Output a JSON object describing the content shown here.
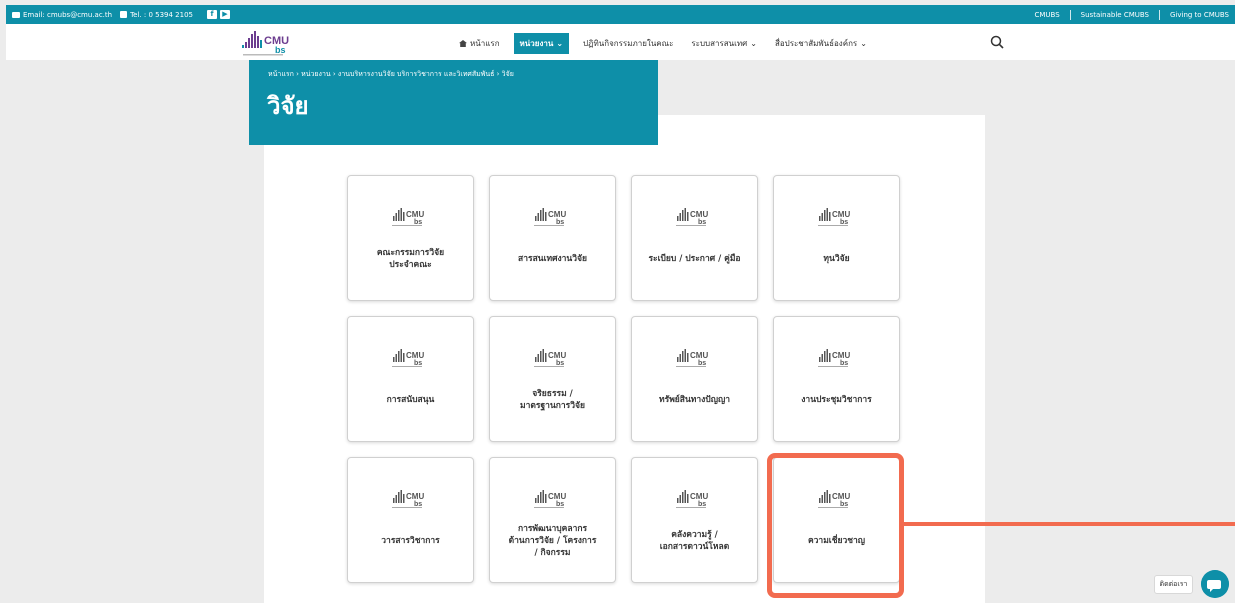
{
  "topbar": {
    "email": "Email: cmubs@cmu.ac.th",
    "tel": "Tel. : 0 5394 2105",
    "social": [
      "facebook-icon",
      "youtube-icon"
    ],
    "links": [
      "CMUBS",
      "Sustainable CMUBS",
      "Giving to CMUBS"
    ]
  },
  "nav": {
    "home": "หน้าแรก",
    "items": [
      {
        "label": "หน่วยงาน",
        "active": true,
        "dropdown": true
      },
      {
        "label": "ปฏิทินกิจกรรมภายในคณะ",
        "active": false,
        "dropdown": false
      },
      {
        "label": "ระบบสารสนเทศ",
        "active": false,
        "dropdown": true
      },
      {
        "label": "สื่อประชาสัมพันธ์องค์กร",
        "active": false,
        "dropdown": true
      }
    ]
  },
  "hero": {
    "breadcrumb": "หน้าแรก › หน่วยงาน › งานบริหารงานวิจัย บริการวิชาการ และวิเทศสัมพันธ์ › วิจัย",
    "title": "วิจัย"
  },
  "cards": [
    "คณะกรรมการวิจัย\nประจำคณะ",
    "สารสนเทศงานวิจัย",
    "ระเบียบ / ประกาศ / คู่มือ",
    "ทุนวิจัย",
    "การสนับสนุน",
    "จริยธรรม /\nมาตรฐานการวิจัย",
    "ทรัพย์สินทางปัญญา",
    "งานประชุมวิชาการ",
    "วารสารวิชาการ",
    "การพัฒนาบุคลากร\nด้านการวิจัย / โครงการ\n/ กิจกรรม",
    "คลังความรู้ /\nเอกสารดาวน์โหลด",
    "ความเชี่ยวชาญ"
  ],
  "chat": {
    "label": "ติดต่อเรา"
  },
  "colors": {
    "primary": "#0e8fa8",
    "highlight": "#f26b4f"
  }
}
